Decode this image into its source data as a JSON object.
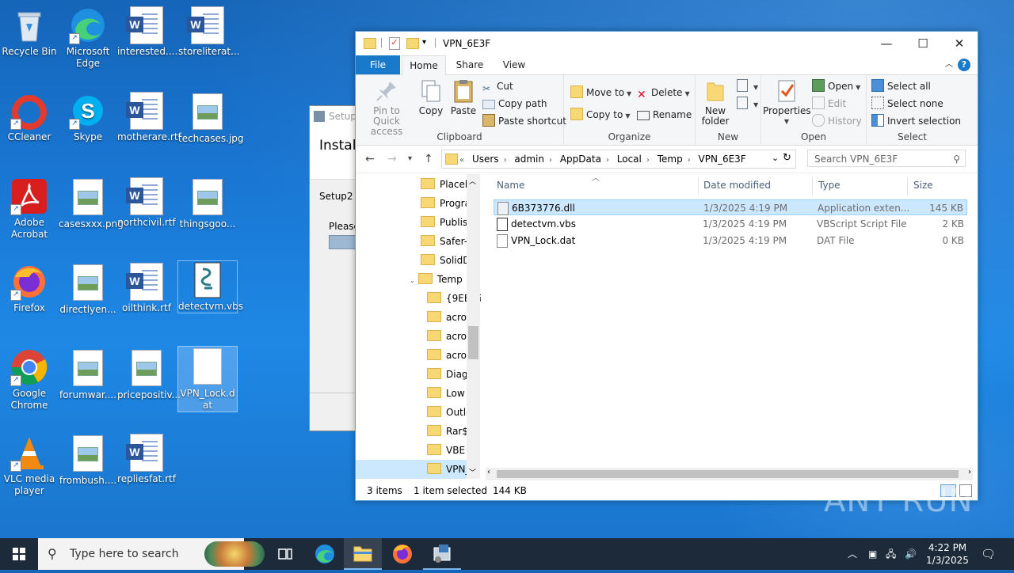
{
  "desktop": {
    "icons": [
      {
        "label": "Recycle Bin"
      },
      {
        "label": "Microsoft Edge"
      },
      {
        "label": "interested...."
      },
      {
        "label": "storeliterat..."
      },
      {
        "label": "CCleaner"
      },
      {
        "label": "Skype"
      },
      {
        "label": "motherare.rtf"
      },
      {
        "label": "techcases.jpg"
      },
      {
        "label": "Adobe Acrobat"
      },
      {
        "label": "casesxxx.png"
      },
      {
        "label": "northcivil.rtf"
      },
      {
        "label": "thingsgoo..."
      },
      {
        "label": "Firefox"
      },
      {
        "label": "directlyen..."
      },
      {
        "label": "oilthink.rtf"
      },
      {
        "label": "detectvm.vbs"
      },
      {
        "label": "Google Chrome"
      },
      {
        "label": "forumwar...."
      },
      {
        "label": "pricepositiv..."
      },
      {
        "label": "VPN_Lock.dat"
      },
      {
        "label": "VLC media player"
      },
      {
        "label": "frombush...."
      },
      {
        "label": "repliesfat.rtf"
      }
    ]
  },
  "setup": {
    "title": "Setup2",
    "heading": "Instal",
    "line1": "Setup2 is",
    "line2": "Please"
  },
  "explorer": {
    "title": "VPN_6E3F",
    "tabs": {
      "file": "File",
      "home": "Home",
      "share": "Share",
      "view": "View"
    },
    "ribbon": {
      "clipboard": {
        "label": "Clipboard",
        "pin": "Pin to Quick access",
        "copy": "Copy",
        "paste": "Paste",
        "cut": "Cut",
        "copy_path": "Copy path",
        "paste_shortcut": "Paste shortcut"
      },
      "organize": {
        "label": "Organize",
        "move_to": "Move to",
        "copy_to": "Copy to",
        "delete": "Delete",
        "rename": "Rename"
      },
      "new": {
        "label": "New",
        "new_folder": "New folder"
      },
      "open": {
        "label": "Open",
        "properties": "Properties",
        "open": "Open",
        "edit": "Edit",
        "history": "History"
      },
      "select": {
        "label": "Select",
        "select_all": "Select all",
        "select_none": "Select none",
        "invert": "Invert selection"
      }
    },
    "address": {
      "crumbs": [
        "Users",
        "admin",
        "AppData",
        "Local",
        "Temp",
        "VPN_6E3F"
      ],
      "search_placeholder": "Search VPN_6E3F"
    },
    "nav_items": [
      "Placeho",
      "Progran",
      "Publish",
      "Safer-N",
      "SolidDo",
      "Temp",
      "{9EE25",
      "acrob",
      "acroc",
      "acror",
      "Diagn",
      "Low",
      "Outlo",
      "Rar$D",
      "VBE",
      "VPN_("
    ],
    "columns": {
      "name": "Name",
      "date": "Date modified",
      "type": "Type",
      "size": "Size"
    },
    "files": [
      {
        "name": "6B373776.dll",
        "date": "1/3/2025 4:19 PM",
        "type": "Application exten...",
        "size": "145 KB"
      },
      {
        "name": "detectvm.vbs",
        "date": "1/3/2025 4:19 PM",
        "type": "VBScript Script File",
        "size": "2 KB"
      },
      {
        "name": "VPN_Lock.dat",
        "date": "1/3/2025 4:19 PM",
        "type": "DAT File",
        "size": "0 KB"
      }
    ],
    "status": {
      "items": "3 items",
      "selected": "1 item selected",
      "size": "144 KB"
    }
  },
  "taskbar": {
    "search_placeholder": "Type here to search",
    "time": "4:22 PM",
    "date": "1/3/2025"
  },
  "watermark": "ANY RUN"
}
